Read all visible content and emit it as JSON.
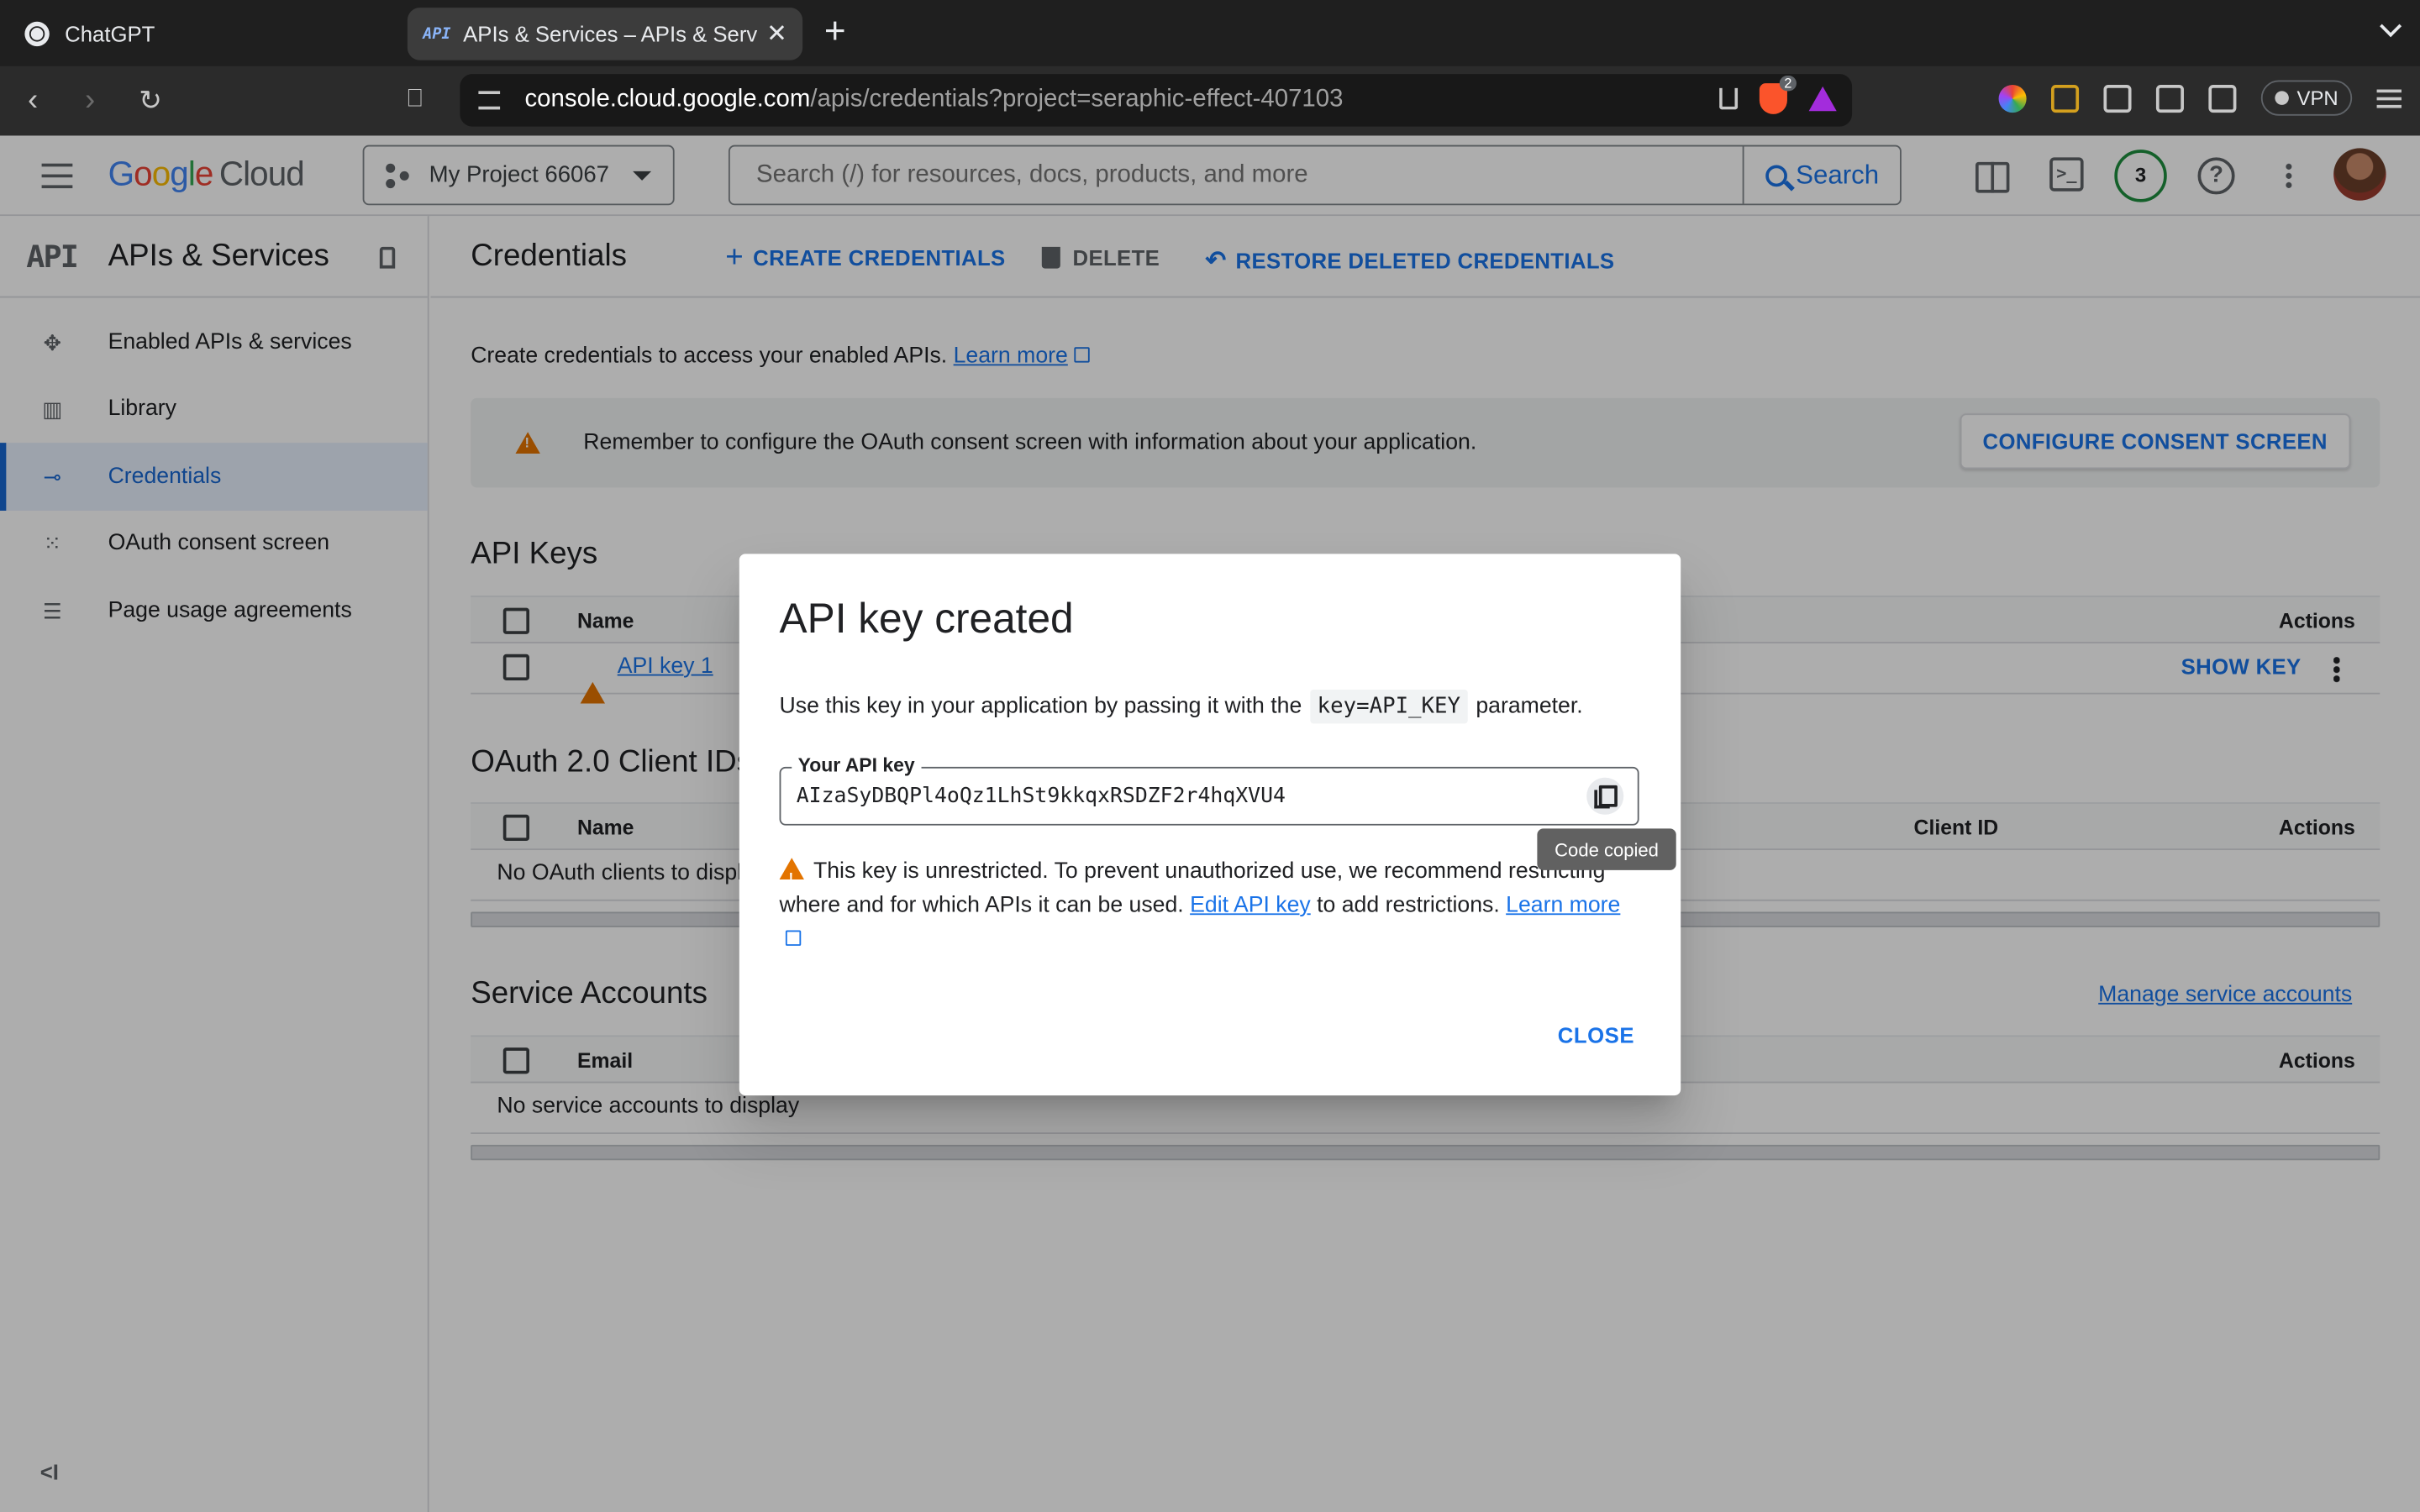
{
  "browser": {
    "tabs": [
      {
        "title": "ChatGPT"
      },
      {
        "title": "APIs & Services – APIs & Services – Credentials"
      }
    ],
    "url_host": "console.cloud.google.com",
    "url_path": "/apis/credentials?project=seraphic-effect-407103",
    "brave_badge": "2",
    "vpn_label": "VPN"
  },
  "header": {
    "logo_letters": [
      "G",
      "o",
      "o",
      "g",
      "l",
      "e"
    ],
    "logo_product": "Cloud",
    "project": "My Project 66067",
    "search_placeholder": "Search (/) for resources, docs, products, and more",
    "search_button": "Search",
    "notifications_count": "3"
  },
  "sidebar": {
    "logo": "API",
    "title": "APIs & Services",
    "items": [
      {
        "label": "Enabled APIs & services",
        "icon": "apis-icon"
      },
      {
        "label": "Library",
        "icon": "library-icon"
      },
      {
        "label": "Credentials",
        "icon": "key-icon",
        "active": true
      },
      {
        "label": "OAuth consent screen",
        "icon": "consent-icon"
      },
      {
        "label": "Page usage agreements",
        "icon": "settings-list-icon"
      }
    ],
    "collapse": "<I"
  },
  "main": {
    "title": "Credentials",
    "actions": {
      "create": "CREATE CREDENTIALS",
      "delete": "DELETE",
      "restore": "RESTORE DELETED CREDENTIALS"
    },
    "intro": "Create credentials to access your enabled APIs.",
    "intro_link": "Learn more",
    "banner_text": "Remember to configure the OAuth consent screen with information about your application.",
    "banner_button": "CONFIGURE CONSENT SCREEN",
    "api_keys": {
      "title": "API Keys",
      "headers": {
        "name": "Name",
        "actions": "Actions"
      },
      "rows": [
        {
          "name": "API key 1",
          "action": "SHOW KEY"
        }
      ]
    },
    "oauth": {
      "title": "OAuth 2.0 Client IDs",
      "headers": {
        "name": "Name",
        "client_id": "Client ID",
        "actions": "Actions"
      },
      "empty": "No OAuth clients to display"
    },
    "service_accounts": {
      "title": "Service Accounts",
      "manage_link": "Manage service accounts",
      "headers": {
        "email": "Email",
        "actions": "Actions"
      },
      "empty": "No service accounts to display"
    }
  },
  "dialog": {
    "title": "API key created",
    "body_prefix": "Use this key in your application by passing it with the",
    "body_code": "key=API_KEY",
    "body_suffix": "parameter.",
    "field_label": "Your API key",
    "api_key": "AIzaSyDBQPl4oQz1LhSt9kkqxRSDZF2r4hqXVU4",
    "tooltip": "Code copied",
    "warning_prefix": "This key is unrestricted. To prevent unauthorized use, we recommend restricting where and for which APIs it can be used.",
    "warning_link": "Edit API key",
    "warning_middle": "to add restrictions.",
    "warning_learn": "Learn more",
    "close": "CLOSE"
  }
}
